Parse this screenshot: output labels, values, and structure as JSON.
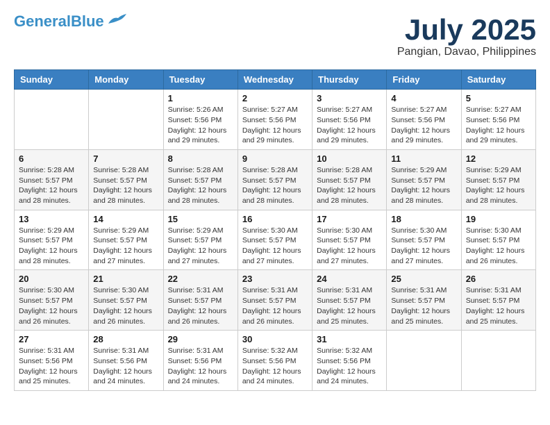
{
  "header": {
    "logo_line1": "General",
    "logo_line2": "Blue",
    "month": "July 2025",
    "location": "Pangian, Davao, Philippines"
  },
  "weekdays": [
    "Sunday",
    "Monday",
    "Tuesday",
    "Wednesday",
    "Thursday",
    "Friday",
    "Saturday"
  ],
  "weeks": [
    [
      {
        "day": "",
        "sunrise": "",
        "sunset": "",
        "daylight": ""
      },
      {
        "day": "",
        "sunrise": "",
        "sunset": "",
        "daylight": ""
      },
      {
        "day": "1",
        "sunrise": "Sunrise: 5:26 AM",
        "sunset": "Sunset: 5:56 PM",
        "daylight": "Daylight: 12 hours and 29 minutes."
      },
      {
        "day": "2",
        "sunrise": "Sunrise: 5:27 AM",
        "sunset": "Sunset: 5:56 PM",
        "daylight": "Daylight: 12 hours and 29 minutes."
      },
      {
        "day": "3",
        "sunrise": "Sunrise: 5:27 AM",
        "sunset": "Sunset: 5:56 PM",
        "daylight": "Daylight: 12 hours and 29 minutes."
      },
      {
        "day": "4",
        "sunrise": "Sunrise: 5:27 AM",
        "sunset": "Sunset: 5:56 PM",
        "daylight": "Daylight: 12 hours and 29 minutes."
      },
      {
        "day": "5",
        "sunrise": "Sunrise: 5:27 AM",
        "sunset": "Sunset: 5:56 PM",
        "daylight": "Daylight: 12 hours and 29 minutes."
      }
    ],
    [
      {
        "day": "6",
        "sunrise": "Sunrise: 5:28 AM",
        "sunset": "Sunset: 5:57 PM",
        "daylight": "Daylight: 12 hours and 28 minutes."
      },
      {
        "day": "7",
        "sunrise": "Sunrise: 5:28 AM",
        "sunset": "Sunset: 5:57 PM",
        "daylight": "Daylight: 12 hours and 28 minutes."
      },
      {
        "day": "8",
        "sunrise": "Sunrise: 5:28 AM",
        "sunset": "Sunset: 5:57 PM",
        "daylight": "Daylight: 12 hours and 28 minutes."
      },
      {
        "day": "9",
        "sunrise": "Sunrise: 5:28 AM",
        "sunset": "Sunset: 5:57 PM",
        "daylight": "Daylight: 12 hours and 28 minutes."
      },
      {
        "day": "10",
        "sunrise": "Sunrise: 5:28 AM",
        "sunset": "Sunset: 5:57 PM",
        "daylight": "Daylight: 12 hours and 28 minutes."
      },
      {
        "day": "11",
        "sunrise": "Sunrise: 5:29 AM",
        "sunset": "Sunset: 5:57 PM",
        "daylight": "Daylight: 12 hours and 28 minutes."
      },
      {
        "day": "12",
        "sunrise": "Sunrise: 5:29 AM",
        "sunset": "Sunset: 5:57 PM",
        "daylight": "Daylight: 12 hours and 28 minutes."
      }
    ],
    [
      {
        "day": "13",
        "sunrise": "Sunrise: 5:29 AM",
        "sunset": "Sunset: 5:57 PM",
        "daylight": "Daylight: 12 hours and 28 minutes."
      },
      {
        "day": "14",
        "sunrise": "Sunrise: 5:29 AM",
        "sunset": "Sunset: 5:57 PM",
        "daylight": "Daylight: 12 hours and 27 minutes."
      },
      {
        "day": "15",
        "sunrise": "Sunrise: 5:29 AM",
        "sunset": "Sunset: 5:57 PM",
        "daylight": "Daylight: 12 hours and 27 minutes."
      },
      {
        "day": "16",
        "sunrise": "Sunrise: 5:30 AM",
        "sunset": "Sunset: 5:57 PM",
        "daylight": "Daylight: 12 hours and 27 minutes."
      },
      {
        "day": "17",
        "sunrise": "Sunrise: 5:30 AM",
        "sunset": "Sunset: 5:57 PM",
        "daylight": "Daylight: 12 hours and 27 minutes."
      },
      {
        "day": "18",
        "sunrise": "Sunrise: 5:30 AM",
        "sunset": "Sunset: 5:57 PM",
        "daylight": "Daylight: 12 hours and 27 minutes."
      },
      {
        "day": "19",
        "sunrise": "Sunrise: 5:30 AM",
        "sunset": "Sunset: 5:57 PM",
        "daylight": "Daylight: 12 hours and 26 minutes."
      }
    ],
    [
      {
        "day": "20",
        "sunrise": "Sunrise: 5:30 AM",
        "sunset": "Sunset: 5:57 PM",
        "daylight": "Daylight: 12 hours and 26 minutes."
      },
      {
        "day": "21",
        "sunrise": "Sunrise: 5:30 AM",
        "sunset": "Sunset: 5:57 PM",
        "daylight": "Daylight: 12 hours and 26 minutes."
      },
      {
        "day": "22",
        "sunrise": "Sunrise: 5:31 AM",
        "sunset": "Sunset: 5:57 PM",
        "daylight": "Daylight: 12 hours and 26 minutes."
      },
      {
        "day": "23",
        "sunrise": "Sunrise: 5:31 AM",
        "sunset": "Sunset: 5:57 PM",
        "daylight": "Daylight: 12 hours and 26 minutes."
      },
      {
        "day": "24",
        "sunrise": "Sunrise: 5:31 AM",
        "sunset": "Sunset: 5:57 PM",
        "daylight": "Daylight: 12 hours and 25 minutes."
      },
      {
        "day": "25",
        "sunrise": "Sunrise: 5:31 AM",
        "sunset": "Sunset: 5:57 PM",
        "daylight": "Daylight: 12 hours and 25 minutes."
      },
      {
        "day": "26",
        "sunrise": "Sunrise: 5:31 AM",
        "sunset": "Sunset: 5:57 PM",
        "daylight": "Daylight: 12 hours and 25 minutes."
      }
    ],
    [
      {
        "day": "27",
        "sunrise": "Sunrise: 5:31 AM",
        "sunset": "Sunset: 5:56 PM",
        "daylight": "Daylight: 12 hours and 25 minutes."
      },
      {
        "day": "28",
        "sunrise": "Sunrise: 5:31 AM",
        "sunset": "Sunset: 5:56 PM",
        "daylight": "Daylight: 12 hours and 24 minutes."
      },
      {
        "day": "29",
        "sunrise": "Sunrise: 5:31 AM",
        "sunset": "Sunset: 5:56 PM",
        "daylight": "Daylight: 12 hours and 24 minutes."
      },
      {
        "day": "30",
        "sunrise": "Sunrise: 5:32 AM",
        "sunset": "Sunset: 5:56 PM",
        "daylight": "Daylight: 12 hours and 24 minutes."
      },
      {
        "day": "31",
        "sunrise": "Sunrise: 5:32 AM",
        "sunset": "Sunset: 5:56 PM",
        "daylight": "Daylight: 12 hours and 24 minutes."
      },
      {
        "day": "",
        "sunrise": "",
        "sunset": "",
        "daylight": ""
      },
      {
        "day": "",
        "sunrise": "",
        "sunset": "",
        "daylight": ""
      }
    ]
  ]
}
